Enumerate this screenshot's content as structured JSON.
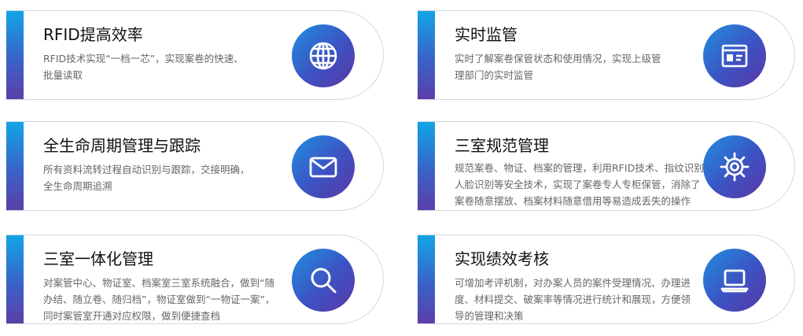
{
  "cards": [
    {
      "title": "RFID提高效率",
      "desc": [
        "RFID技术实现“一档一芯”，实现案卷的快速、",
        "批量读取"
      ],
      "icon": "globe-icon"
    },
    {
      "title": "实时监管",
      "desc": [
        "实时了解案卷保管状态和使用情况，实现上级管",
        "理部门的实时监管"
      ],
      "icon": "id-card-icon"
    },
    {
      "title": "全生命周期管理与跟踪",
      "desc": [
        "所有资料流转过程自动识别与跟踪，交接明确，",
        "全生命周期追溯"
      ],
      "icon": "mail-icon"
    },
    {
      "title": "三室规范管理",
      "desc": [
        "规范案卷、物证、档案的管理，利用RFID技术、指纹识别、",
        "人脸识别等安全技术，实现了案卷专人专柜保管，消除了",
        "案卷随意摆放、档案材料随意借用等易造成丢失的操作"
      ],
      "icon": "gear-icon"
    },
    {
      "title": "三室一体化管理",
      "desc": [
        "对案管中心、物证室、档案室三室系统融合，做到“随",
        "办结、随立卷、随归档”，物证室做到“一物证一案”，",
        "同时案管室开通对应权限，做到便捷查档"
      ],
      "icon": "search-icon"
    },
    {
      "title": "实现绩效考核",
      "desc": [
        "可增加考评机制，对办案人员的案件受理情况、办理进",
        "度、材料提交、破案率等情况进行统计和展现，方便领",
        "导的管理和决策"
      ],
      "icon": "laptop-icon"
    }
  ],
  "colors": {
    "bar_top": "#12a4e6",
    "bar_bottom": "#5b3fa8",
    "icon_start": "#1f8fe0",
    "icon_end": "#5a37a6"
  }
}
